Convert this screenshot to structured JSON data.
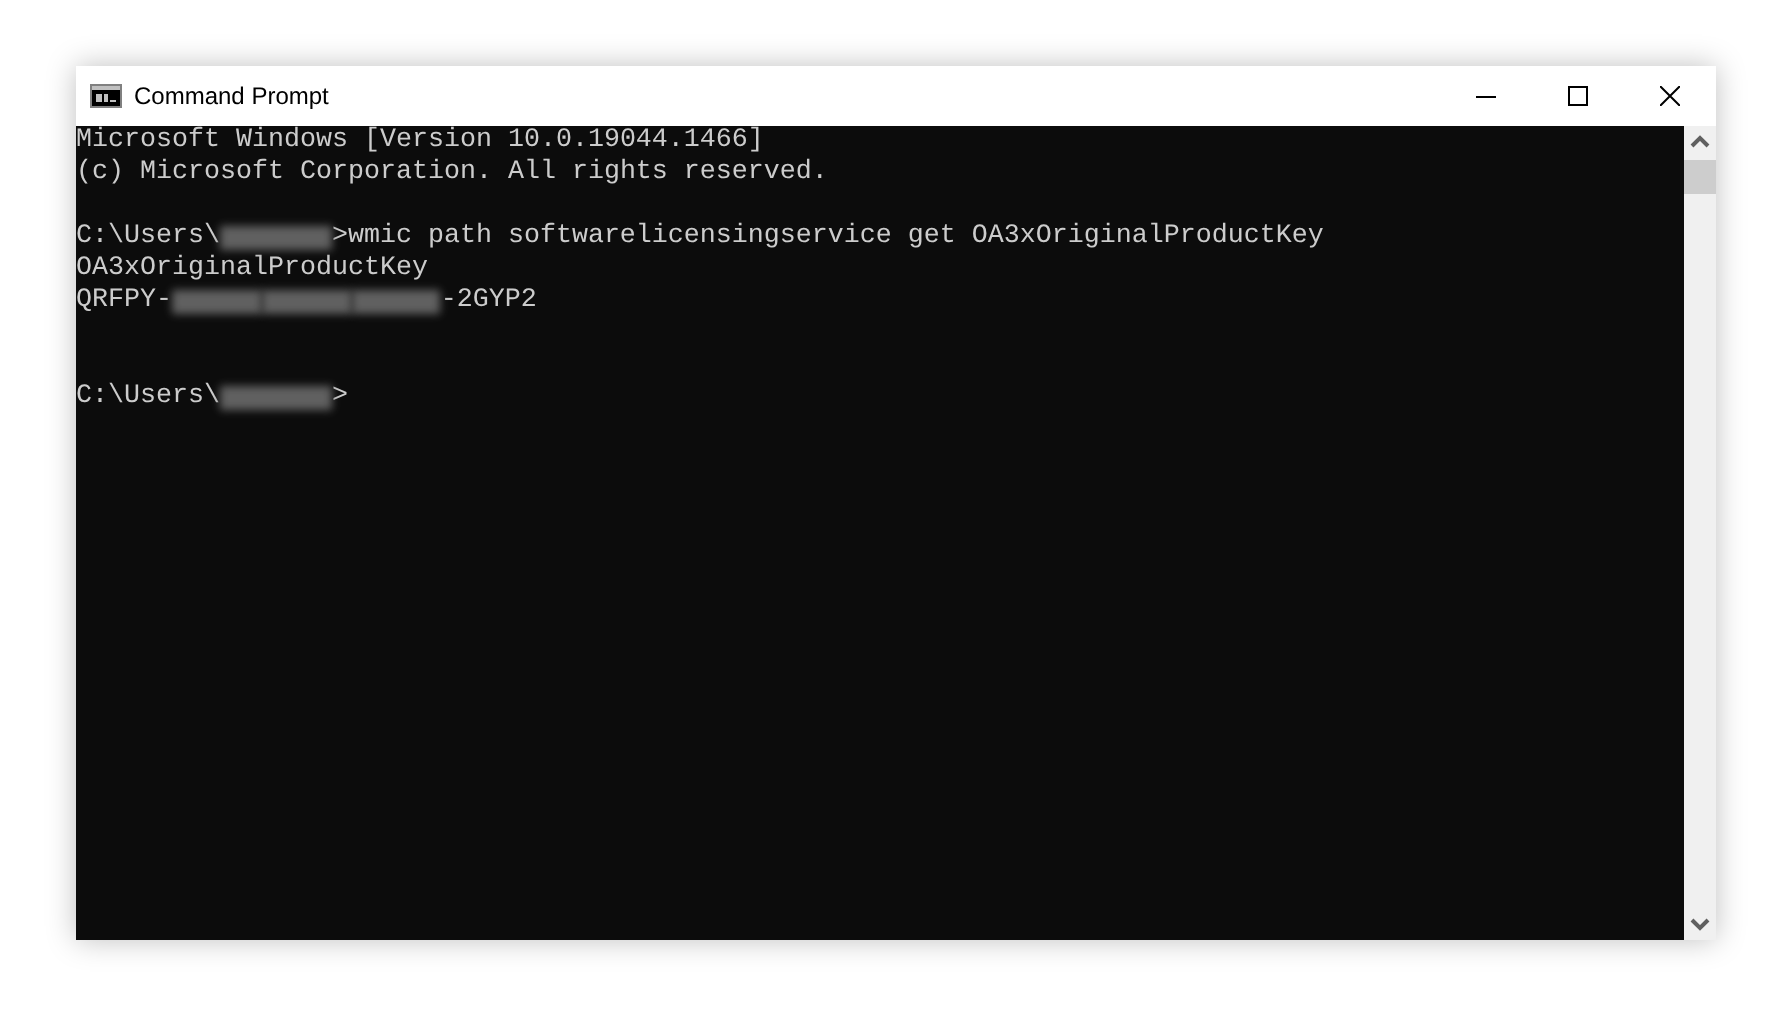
{
  "window": {
    "title": "Command Prompt"
  },
  "console": {
    "lines": [
      {
        "kind": "output",
        "segments": [
          {
            "kind": "text",
            "text": "Microsoft Windows [Version 10.0.19044.1466]"
          }
        ]
      },
      {
        "kind": "output",
        "segments": [
          {
            "kind": "text",
            "text": "(c) Microsoft Corporation. All rights reserved."
          }
        ]
      },
      {
        "kind": "blank"
      },
      {
        "kind": "output",
        "segments": [
          {
            "kind": "text",
            "text": "C:\\Users\\"
          },
          {
            "kind": "redactedname"
          },
          {
            "kind": "text",
            "text": ">wmic path softwarelicensingservice get OA3xOriginalProductKey"
          }
        ]
      },
      {
        "kind": "output",
        "segments": [
          {
            "kind": "text",
            "text": "OA3xOriginalProductKey"
          }
        ]
      },
      {
        "kind": "output",
        "segments": [
          {
            "kind": "text",
            "text": "QRFPY-"
          },
          {
            "kind": "redacted"
          },
          {
            "kind": "redacted"
          },
          {
            "kind": "redacted"
          },
          {
            "kind": "text",
            "text": "-2GYP2"
          }
        ]
      },
      {
        "kind": "blank"
      },
      {
        "kind": "blank"
      },
      {
        "kind": "output",
        "segments": [
          {
            "kind": "text",
            "text": "C:\\Users\\"
          },
          {
            "kind": "redactedname"
          },
          {
            "kind": "text",
            "text": ">"
          }
        ]
      }
    ]
  }
}
